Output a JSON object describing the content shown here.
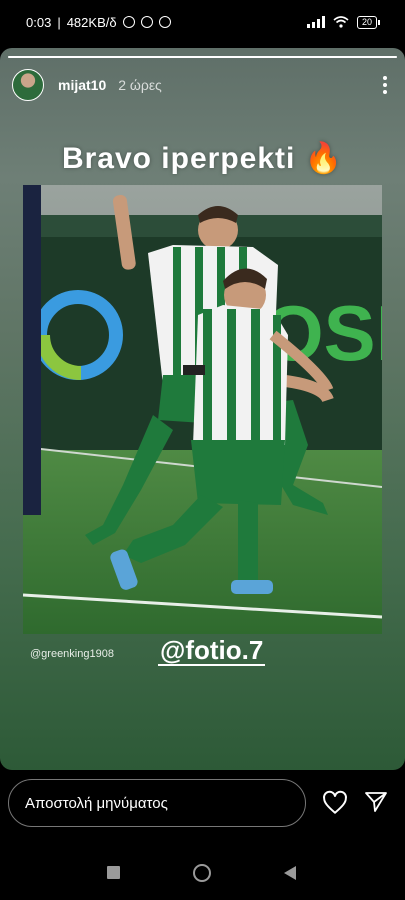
{
  "status_bar": {
    "time": "0:03",
    "speed": "482KB/δ",
    "battery": "20"
  },
  "story": {
    "progress": 1.0,
    "username": "mijat10",
    "time_ago": "2 ώρες",
    "caption": "Bravo iperpekti",
    "caption_emoji": "🔥",
    "photo_credit": "@greenking1908",
    "mention": "@fotio.7"
  },
  "reply": {
    "placeholder": "Αποστολή μηνύματος"
  },
  "icons": {
    "more": "more-vertical-icon",
    "heart": "heart-icon",
    "send": "send-icon",
    "nav_recent": "square-icon",
    "nav_home": "circle-icon",
    "nav_back": "triangle-back-icon"
  },
  "colors": {
    "kit_green": "#1f7a3c",
    "kit_white": "#f2f2f2",
    "pitch": "#3d7a3a"
  }
}
